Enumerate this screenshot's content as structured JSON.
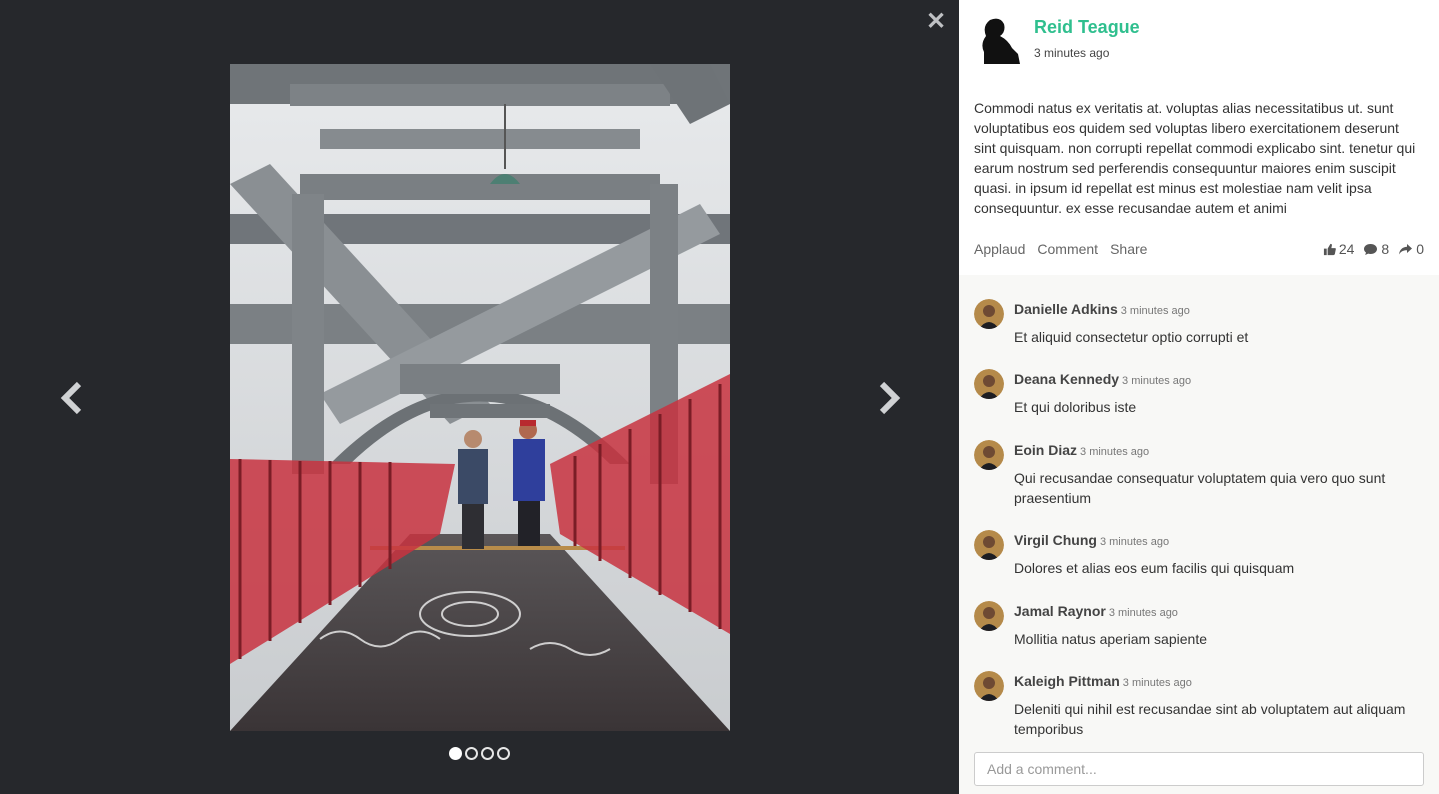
{
  "viewer": {
    "close_icon": "close-icon",
    "prev_icon": "chevron-left-icon",
    "next_icon": "chevron-right-icon",
    "slides_total": 4,
    "active_slide": 1
  },
  "post": {
    "author": "Reid Teague",
    "time": "3 minutes ago",
    "text": "Commodi natus ex veritatis at. voluptas alias necessitatibus ut. sunt voluptatibus eos quidem sed voluptas libero exercitationem deserunt sint quisquam. non corrupti repellat commodi explicabo sint. tenetur qui earum nostrum sed perferendis consequuntur maiores enim suscipit quasi. in ipsum id repellat est minus est molestiae nam velit ipsa consequuntur. ex esse recusandae autem et animi",
    "actions": {
      "applaud": "Applaud",
      "comment": "Comment",
      "share": "Share"
    },
    "stats": {
      "applauds": "24",
      "comments": "8",
      "shares": "0"
    }
  },
  "comments": [
    {
      "name": "Danielle Adkins",
      "time": "3 minutes ago",
      "text": "Et aliquid consectetur optio corrupti et"
    },
    {
      "name": "Deana Kennedy",
      "time": "3 minutes ago",
      "text": "Et qui doloribus iste"
    },
    {
      "name": "Eoin Diaz",
      "time": "3 minutes ago",
      "text": "Qui recusandae consequatur voluptatem quia vero quo sunt praesentium"
    },
    {
      "name": "Virgil Chung",
      "time": "3 minutes ago",
      "text": "Dolores et alias eos eum facilis qui quisquam"
    },
    {
      "name": "Jamal Raynor",
      "time": "3 minutes ago",
      "text": "Mollitia natus aperiam sapiente"
    },
    {
      "name": "Kaleigh Pittman",
      "time": "3 minutes ago",
      "text": "Deleniti qui nihil est recusandae sint ab voluptatem aut aliquam temporibus"
    }
  ],
  "comment_input": {
    "placeholder": "Add a comment..."
  },
  "colors": {
    "accent": "#2fbf8e",
    "viewer_bg": "#26282c",
    "railing": "#d63a4a"
  }
}
